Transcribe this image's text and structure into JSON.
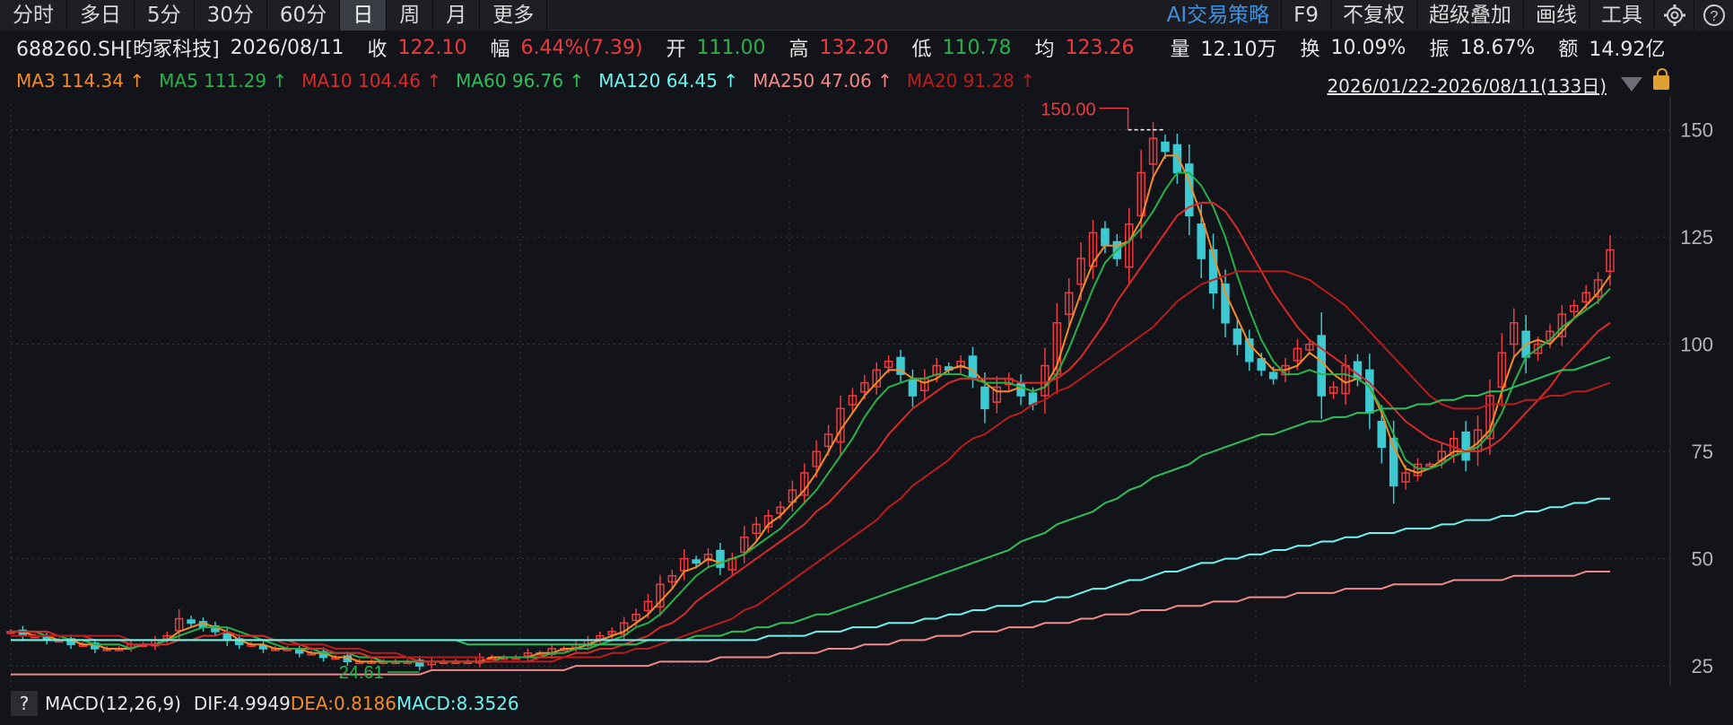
{
  "tabs": [
    {
      "label": "分时"
    },
    {
      "label": "多日"
    },
    {
      "label": "5分"
    },
    {
      "label": "30分"
    },
    {
      "label": "60分"
    },
    {
      "label": "日"
    },
    {
      "label": "周"
    },
    {
      "label": "月"
    },
    {
      "label": "更多"
    }
  ],
  "active_tab": "日",
  "tools": {
    "ai": "AI交易策略",
    "f9": "F9",
    "restore": "不复权",
    "overlay": "超级叠加",
    "draw": "画线",
    "toolkit": "工具",
    "settings_icon": "gear-icon",
    "help_icon": "help-icon",
    "help_glyph": "?"
  },
  "quote": {
    "symbol": "688260.SH[昀冢科技]",
    "date": "2026/08/11",
    "close_label": "收",
    "close": "122.10",
    "change_label": "幅",
    "change": "6.44%(7.39)",
    "open_label": "开",
    "open": "111.00",
    "high_label": "高",
    "high": "132.20",
    "low_label": "低",
    "low": "110.78",
    "avg_label": "均",
    "avg": "123.26",
    "vol_label": "量",
    "vol": "12.10万",
    "turn_label": "换",
    "turn": "10.09%",
    "amp_label": "振",
    "amp": "18.67%",
    "amt_label": "额",
    "amt": "14.92亿"
  },
  "ma_legend": [
    {
      "text": "MA3 114.34 ↑",
      "color": "#f28c28"
    },
    {
      "text": "MA5 111.29 ↑",
      "color": "#28b04a"
    },
    {
      "text": "MA10 104.46 ↑",
      "color": "#d82a2a"
    },
    {
      "text": "MA60 96.76 ↑",
      "color": "#2fbf5a"
    },
    {
      "text": "MA120 64.45 ↑",
      "color": "#6ff3f0"
    },
    {
      "text": "MA250 47.06 ↑",
      "color": "#f08a8a"
    },
    {
      "text": "MA20 91.28 ↑",
      "color": "#b81c1c"
    }
  ],
  "range_label": "2026/01/22-2026/08/11(133日)",
  "colors": {
    "up": "#ec3a3f",
    "down": "#3cc9d2",
    "ma3": "#f28c28",
    "ma5": "#28b04a",
    "ma10": "#d82a2a",
    "ma20": "#b81c1c",
    "ma60": "#2fbf5a",
    "ma120": "#6ff3f0",
    "ma250": "#f08a8a"
  },
  "macd": {
    "help": "?",
    "name": "MACD(12,26,9)",
    "dif": "DIF:4.9949",
    "dea": "DEA:0.8186",
    "macd": "MACD:8.3526"
  },
  "chart_data": {
    "type": "candlestick",
    "y_ticks": [
      25,
      50,
      75,
      100,
      125,
      150
    ],
    "ylim": [
      20,
      156
    ],
    "annotations": [
      {
        "label": "150.00",
        "value": 150.0
      },
      {
        "label": "24.61",
        "value": 24.61
      }
    ],
    "closes": [
      33,
      32,
      32,
      31,
      31,
      30,
      30,
      29,
      29,
      29,
      30,
      30,
      31,
      32,
      36,
      35,
      34,
      33,
      31,
      30,
      30,
      29,
      29,
      29,
      28,
      28,
      27,
      27,
      26,
      26,
      26,
      26,
      26,
      26,
      25,
      26,
      26,
      26,
      26,
      27,
      27,
      27,
      27,
      28,
      28,
      29,
      29,
      30,
      31,
      32,
      33,
      35,
      37,
      40,
      44,
      46,
      50,
      49,
      51,
      48,
      50,
      55,
      58,
      60,
      62,
      66,
      70,
      75,
      79,
      85,
      88,
      91,
      94,
      96,
      93,
      88,
      92,
      95,
      94,
      96,
      92,
      85,
      90,
      92,
      88,
      86,
      95,
      105,
      112,
      120,
      126,
      123,
      120,
      128,
      140,
      148,
      145,
      140,
      130,
      120,
      112,
      105,
      100,
      96,
      94,
      92,
      95,
      99,
      100,
      88,
      90,
      95,
      92,
      84,
      76,
      67,
      70,
      72,
      72,
      75,
      78,
      73,
      80,
      88,
      98,
      105,
      97,
      100,
      103,
      107,
      109,
      112,
      115,
      122
    ],
    "ma_series": [
      {
        "name": "MA3",
        "values": [
          33,
          33,
          32,
          32,
          31,
          31,
          30,
          30,
          29,
          29,
          29,
          30,
          30,
          31,
          33,
          34,
          35,
          34,
          33,
          31,
          30,
          30,
          29,
          29,
          29,
          28,
          28,
          27,
          27,
          26,
          26,
          26,
          26,
          26,
          26,
          26,
          26,
          26,
          26,
          26,
          27,
          27,
          27,
          27,
          28,
          28,
          29,
          29,
          30,
          31,
          32,
          33,
          35,
          37,
          40,
          43,
          47,
          48,
          50,
          49,
          50,
          51,
          54,
          58,
          60,
          63,
          66,
          70,
          75,
          80,
          84,
          88,
          91,
          94,
          94,
          92,
          91,
          92,
          94,
          95,
          94,
          91,
          89,
          89,
          90,
          89,
          90,
          95,
          104,
          112,
          119,
          123,
          123,
          124,
          129,
          139,
          144,
          144,
          138,
          130,
          121,
          112,
          106,
          100,
          97,
          94,
          94,
          95,
          98,
          96,
          93,
          91,
          92,
          90,
          84,
          76,
          71,
          70,
          71,
          73,
          75,
          75,
          77,
          80,
          89,
          97,
          100,
          101,
          100,
          103,
          106,
          109,
          112,
          116
        ]
      },
      {
        "name": "MA5",
        "values": [
          33,
          33,
          33,
          32,
          32,
          31,
          31,
          30,
          30,
          30,
          29,
          30,
          30,
          31,
          32,
          33,
          34,
          34,
          34,
          33,
          32,
          31,
          30,
          29,
          29,
          29,
          28,
          28,
          28,
          27,
          27,
          26,
          26,
          26,
          26,
          26,
          26,
          26,
          26,
          26,
          26,
          27,
          27,
          27,
          27,
          28,
          28,
          29,
          29,
          30,
          31,
          32,
          34,
          35,
          37,
          40,
          43,
          46,
          48,
          49,
          50,
          51,
          53,
          55,
          57,
          60,
          63,
          66,
          70,
          74,
          78,
          83,
          87,
          90,
          91,
          92,
          92,
          93,
          93,
          93,
          92,
          91,
          91,
          91,
          90,
          89,
          90,
          93,
          99,
          106,
          113,
          119,
          122,
          124,
          127,
          131,
          136,
          140,
          140,
          137,
          132,
          125,
          116,
          108,
          101,
          96,
          93,
          93,
          94,
          93,
          93,
          93,
          92,
          90,
          85,
          79,
          73,
          71,
          71,
          72,
          74,
          75,
          76,
          79,
          84,
          91,
          97,
          99,
          101,
          104,
          106,
          108,
          110,
          113
        ]
      },
      {
        "name": "MA10",
        "values": [
          33,
          33,
          33,
          33,
          32,
          32,
          32,
          31,
          31,
          31,
          30,
          30,
          30,
          30,
          31,
          31,
          32,
          32,
          33,
          32,
          32,
          32,
          31,
          31,
          30,
          29,
          29,
          28,
          28,
          28,
          27,
          27,
          27,
          27,
          26,
          26,
          26,
          26,
          26,
          26,
          26,
          26,
          26,
          26,
          27,
          27,
          27,
          28,
          28,
          29,
          29,
          30,
          31,
          32,
          34,
          35,
          37,
          40,
          42,
          44,
          46,
          48,
          50,
          52,
          54,
          56,
          58,
          61,
          63,
          66,
          69,
          72,
          75,
          79,
          82,
          85,
          87,
          89,
          91,
          92,
          92,
          92,
          92,
          92,
          91,
          91,
          91,
          92,
          94,
          97,
          101,
          105,
          110,
          114,
          118,
          122,
          126,
          130,
          132,
          133,
          133,
          131,
          127,
          122,
          117,
          112,
          108,
          104,
          101,
          99,
          97,
          95,
          93,
          91,
          88,
          85,
          82,
          80,
          78,
          77,
          76,
          75,
          75,
          76,
          78,
          81,
          84,
          87,
          90,
          94,
          97,
          100,
          103,
          105
        ]
      },
      {
        "name": "MA20",
        "values": [
          32,
          32,
          32,
          32,
          32,
          32,
          32,
          32,
          32,
          32,
          31,
          31,
          31,
          31,
          31,
          31,
          31,
          31,
          31,
          31,
          31,
          31,
          31,
          30,
          30,
          30,
          30,
          29,
          29,
          29,
          28,
          28,
          28,
          27,
          27,
          27,
          27,
          27,
          27,
          27,
          26,
          26,
          26,
          26,
          26,
          26,
          27,
          27,
          27,
          27,
          28,
          28,
          29,
          29,
          30,
          31,
          32,
          33,
          34,
          35,
          36,
          38,
          39,
          41,
          43,
          45,
          47,
          49,
          51,
          53,
          55,
          57,
          59,
          62,
          64,
          67,
          69,
          71,
          73,
          76,
          78,
          79,
          81,
          83,
          84,
          86,
          87,
          89,
          90,
          92,
          94,
          96,
          98,
          100,
          102,
          104,
          107,
          110,
          112,
          114,
          115,
          116,
          117,
          117,
          117,
          117,
          117,
          116,
          115,
          113,
          111,
          109,
          106,
          103,
          100,
          97,
          94,
          91,
          88,
          86,
          85,
          85,
          85,
          86,
          86,
          86,
          87,
          87,
          88,
          88,
          89,
          89,
          90,
          91
        ]
      },
      {
        "name": "MA60",
        "values": [
          31,
          31,
          31,
          31,
          31,
          31,
          31,
          31,
          31,
          31,
          31,
          31,
          31,
          31,
          31,
          31,
          31,
          31,
          31,
          31,
          31,
          31,
          31,
          31,
          31,
          31,
          31,
          31,
          31,
          31,
          31,
          31,
          31,
          31,
          31,
          31,
          31,
          31,
          30,
          30,
          30,
          30,
          30,
          30,
          30,
          30,
          30,
          30,
          30,
          30,
          30,
          30,
          30,
          31,
          31,
          31,
          31,
          32,
          32,
          32,
          33,
          33,
          34,
          34,
          35,
          35,
          36,
          37,
          37,
          38,
          39,
          40,
          41,
          42,
          43,
          44,
          45,
          46,
          47,
          48,
          49,
          50,
          51,
          52,
          54,
          55,
          56,
          58,
          59,
          60,
          61,
          63,
          64,
          66,
          67,
          69,
          70,
          71,
          72,
          74,
          75,
          76,
          77,
          78,
          79,
          79,
          80,
          81,
          82,
          82,
          83,
          83,
          84,
          84,
          85,
          85,
          85,
          86,
          86,
          87,
          87,
          88,
          88,
          89,
          89,
          90,
          91,
          92,
          93,
          94,
          94,
          95,
          96,
          97
        ]
      },
      {
        "name": "MA120",
        "values": [
          31,
          31,
          31,
          31,
          31,
          31,
          31,
          31,
          31,
          31,
          31,
          31,
          31,
          31,
          31,
          31,
          31,
          31,
          31,
          31,
          31,
          31,
          31,
          31,
          31,
          31,
          31,
          31,
          31,
          31,
          31,
          31,
          31,
          31,
          31,
          31,
          31,
          31,
          31,
          31,
          31,
          31,
          31,
          31,
          31,
          31,
          31,
          31,
          31,
          31,
          31,
          31,
          31,
          31,
          31,
          31,
          31,
          31,
          31,
          31,
          31,
          31,
          31,
          32,
          32,
          32,
          32,
          33,
          33,
          33,
          34,
          34,
          34,
          35,
          35,
          35,
          36,
          36,
          37,
          37,
          38,
          38,
          39,
          39,
          39,
          40,
          40,
          41,
          41,
          42,
          43,
          43,
          44,
          45,
          45,
          46,
          47,
          47,
          48,
          49,
          49,
          50,
          50,
          51,
          51,
          52,
          52,
          53,
          53,
          54,
          54,
          55,
          55,
          56,
          56,
          56,
          57,
          57,
          57,
          58,
          58,
          59,
          59,
          59,
          60,
          60,
          61,
          61,
          62,
          62,
          63,
          63,
          64,
          64
        ]
      },
      {
        "name": "MA250",
        "values": [
          23,
          23,
          23,
          23,
          23,
          23,
          23,
          23,
          23,
          23,
          23,
          23,
          23,
          23,
          23,
          23,
          23,
          23,
          23,
          23,
          23,
          23,
          23,
          23,
          23,
          23,
          23,
          23,
          23,
          23,
          23,
          23,
          23,
          23,
          23,
          24,
          24,
          24,
          24,
          24,
          24,
          24,
          24,
          24,
          24,
          24,
          24,
          25,
          25,
          25,
          25,
          25,
          25,
          25,
          26,
          26,
          26,
          26,
          26,
          27,
          27,
          27,
          27,
          27,
          28,
          28,
          28,
          28,
          29,
          29,
          29,
          30,
          30,
          30,
          31,
          31,
          31,
          32,
          32,
          32,
          33,
          33,
          33,
          34,
          34,
          34,
          35,
          35,
          35,
          36,
          36,
          37,
          37,
          37,
          38,
          38,
          38,
          39,
          39,
          39,
          40,
          40,
          40,
          41,
          41,
          41,
          41,
          42,
          42,
          42,
          42,
          43,
          43,
          43,
          43,
          44,
          44,
          44,
          44,
          44,
          45,
          45,
          45,
          45,
          45,
          46,
          46,
          46,
          46,
          46,
          46,
          47,
          47,
          47
        ]
      }
    ]
  }
}
